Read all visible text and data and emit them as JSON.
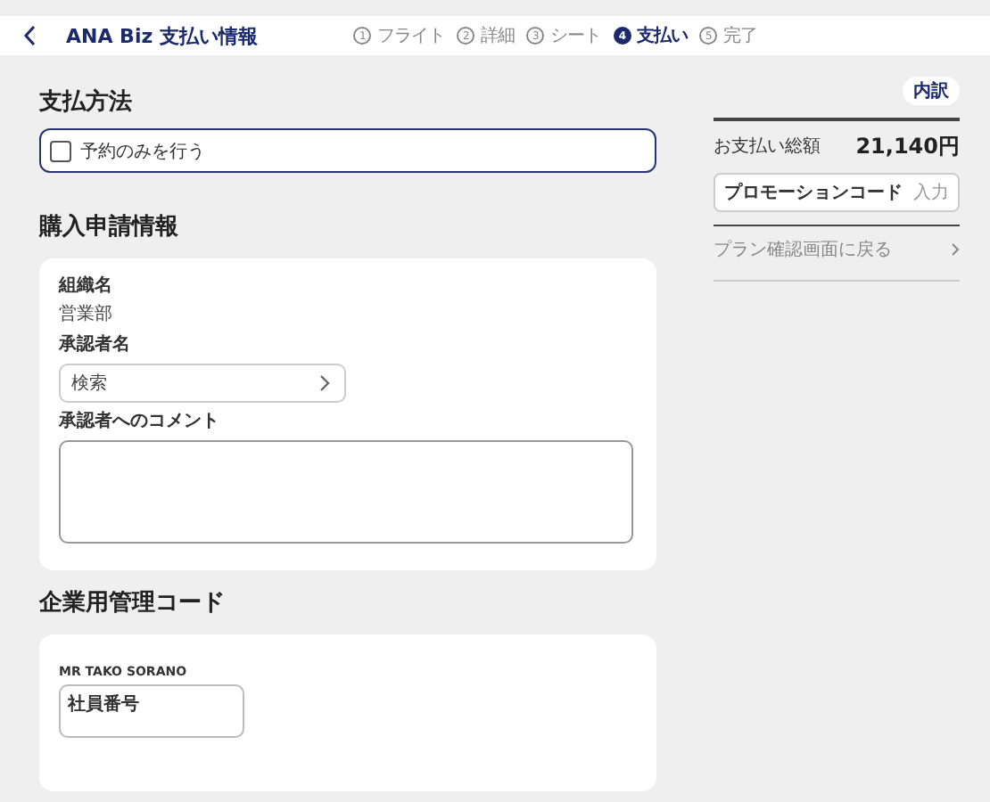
{
  "header": {
    "title": "ANA Biz 支払い情報",
    "steps": [
      {
        "number": "1",
        "label": "フライト",
        "selected": false
      },
      {
        "number": "2",
        "label": "詳細",
        "selected": false
      },
      {
        "number": "3",
        "label": "シート",
        "selected": false
      },
      {
        "number": "4",
        "label": "支払い",
        "selected": true
      },
      {
        "number": "5",
        "label": "完了",
        "selected": false
      }
    ]
  },
  "payment": {
    "title": "支払方法",
    "option": {
      "label": "予約のみを行う",
      "checked": false
    }
  },
  "purchase": {
    "title": "購入申請情報",
    "org_label": "組織名",
    "org_value": "営業部",
    "approver_label": "承認者名",
    "approver_placeholder": "検索",
    "comment_label": "承認者へのコメント"
  },
  "corporate": {
    "title": "企業用管理コード",
    "passenger": "MR TAKO SORANO",
    "employee_placeholder": "社員番号"
  },
  "summary": {
    "breakdown": "内訳",
    "total_label": "お支払い総額",
    "total": "21,140円",
    "promo_label": "プロモーションコード",
    "promo_action": "入力",
    "back_link": "プラン確認画面に戻る"
  }
}
